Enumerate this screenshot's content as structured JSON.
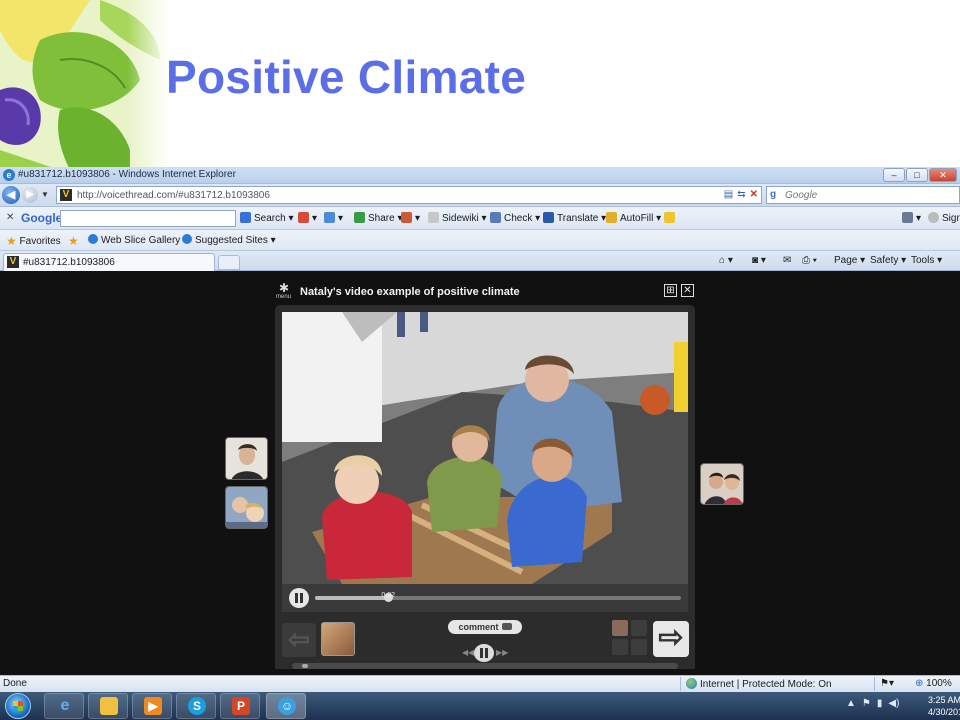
{
  "slide": {
    "title": "Positive Climate"
  },
  "browser": {
    "window_title": "#u831712.b1093806 - Windows Internet Explorer",
    "window_buttons": [
      "–",
      "□",
      "✕"
    ],
    "url": "http://voicethread.com/#u831712.b1093806",
    "search_placeholder": "Google",
    "google_toolbar": {
      "logo": "Google",
      "items": [
        "Search",
        "Share",
        "Sidewiki",
        "Check",
        "Translate",
        "AutoFill"
      ],
      "right_label": "Sign"
    },
    "favorites": {
      "label": "Favorites",
      "items": [
        "Web Slice Gallery",
        "Suggested Sites"
      ]
    },
    "tab": {
      "title": "#u831712.b1093806"
    },
    "command_bar": [
      "Page",
      "Safety",
      "Tools"
    ],
    "status": {
      "left": "Done",
      "zone": "Internet | Protected Mode: On",
      "zoom": "100%"
    }
  },
  "voicethread": {
    "menu_label": "menu",
    "title": "Nataly's video example of positive climate",
    "time": "0:02",
    "progress": 0.2,
    "comment_label": "comment"
  },
  "taskbar": {
    "time": "3:25 AM",
    "date": "4/30/201"
  },
  "colors": {
    "title": "#5b6ee8",
    "content_background": "#111111",
    "player_background": "#2c2c2c"
  }
}
